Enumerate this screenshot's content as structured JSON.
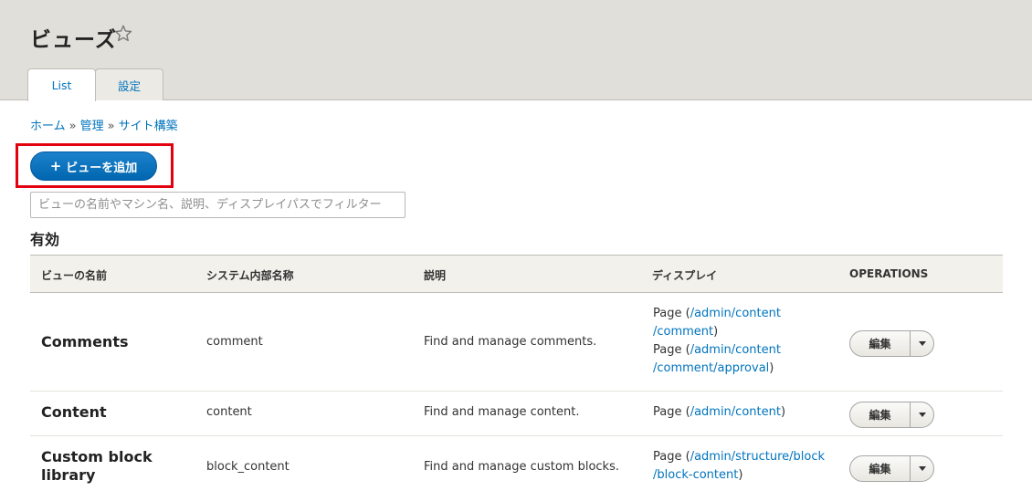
{
  "page": {
    "title": "ビューズ",
    "star_icon": "star-outline-icon"
  },
  "tabs": [
    {
      "label": "List",
      "active": true
    },
    {
      "label": "設定",
      "active": false
    }
  ],
  "breadcrumb": {
    "items": [
      "ホーム",
      "管理",
      "サイト構築"
    ],
    "separator": "»"
  },
  "add_button": {
    "plus": "+",
    "label": "ビューを追加",
    "highlight_color": "#e3000f"
  },
  "filter": {
    "placeholder": "ビューの名前やマシン名、説明、ディスプレイパスでフィルター"
  },
  "section": {
    "heading": "有効"
  },
  "table": {
    "headers": [
      "ビューの名前",
      "システム内部名称",
      "説明",
      "ディスプレイ",
      "OPERATIONS"
    ],
    "rows": [
      {
        "name": "Comments",
        "machine_name": "comment",
        "description": "Find and manage comments.",
        "display_lines": [
          {
            "pre": "Page (",
            "link": "/admin/content",
            "post": ""
          },
          {
            "pre": "",
            "link": "/comment",
            "post": ")"
          },
          {
            "pre": "Page (",
            "link": "/admin/content",
            "post": ""
          },
          {
            "pre": "",
            "link": "/comment/approval",
            "post": ")"
          }
        ],
        "edit_label": "編集"
      },
      {
        "name": "Content",
        "machine_name": "content",
        "description": "Find and manage content.",
        "display_lines": [
          {
            "pre": "Page (",
            "link": "/admin/content",
            "post": ")"
          }
        ],
        "edit_label": "編集"
      },
      {
        "name_lines": [
          "Custom block",
          "library"
        ],
        "machine_name": "block_content",
        "description": "Find and manage custom blocks.",
        "display_lines": [
          {
            "pre": "Page (",
            "link": "/admin/structure/block",
            "post": ""
          },
          {
            "pre": "",
            "link": "/block-content",
            "post": ")"
          }
        ],
        "edit_label": "編集"
      }
    ]
  },
  "colors": {
    "header_bg": "#e0dfd9",
    "link": "#0074bd",
    "primary_button": "#0071b8"
  }
}
